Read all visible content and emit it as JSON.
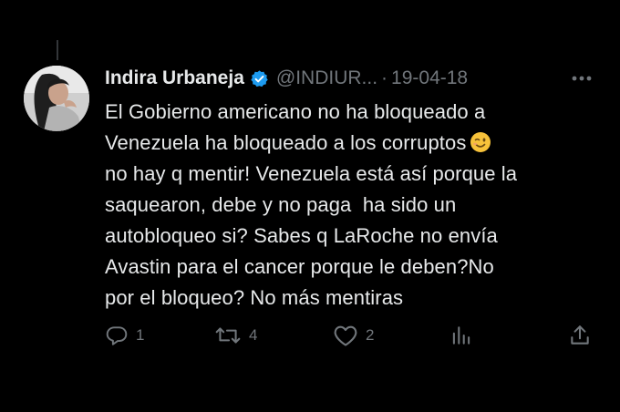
{
  "colors": {
    "background": "#000000",
    "text_primary": "#e7e9ea",
    "text_secondary": "#71767b",
    "verified_badge": "#1d9bf0"
  },
  "tweet": {
    "author": {
      "display_name": "Indira Urbaneja",
      "verified": true,
      "handle": "@INDIUR...",
      "avatar_icon": "profile-photo"
    },
    "separator": "·",
    "date": "19-04-18",
    "text_lines": [
      "El Gobierno americano no ha bloqueado a",
      "Venezuela ha bloqueado a los corruptos",
      "no hay q mentir! Venezuela está así porque la",
      "saquearon, debe y no paga  ha sido un",
      "autobloqueo si? Sabes q LaRoche no envía",
      "Avastin para el cancer porque le deben?No",
      "por el bloqueo? No más mentiras"
    ],
    "emoji": "winking-face",
    "actions": {
      "reply": {
        "icon": "reply-icon",
        "count": "1"
      },
      "retweet": {
        "icon": "retweet-icon",
        "count": "4"
      },
      "like": {
        "icon": "heart-icon",
        "count": "2"
      },
      "views": {
        "icon": "views-icon",
        "count": ""
      },
      "share": {
        "icon": "share-icon",
        "count": ""
      }
    },
    "more_icon": "more-horizontal-icon"
  }
}
